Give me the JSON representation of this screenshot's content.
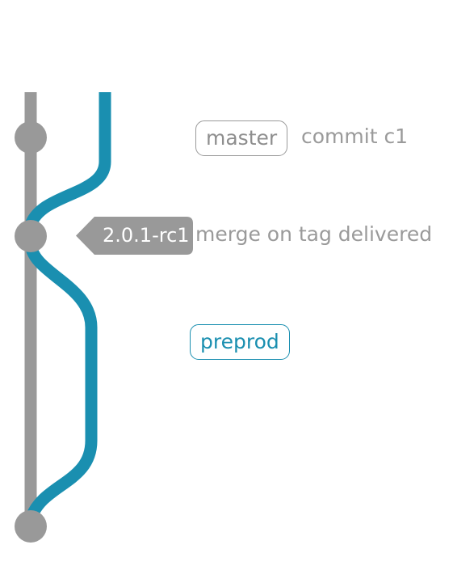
{
  "colors": {
    "master": "#999999",
    "preprod": "#1a8fb0",
    "tag": "#999999"
  },
  "branches": {
    "master": {
      "label": "master"
    },
    "preprod": {
      "label": "preprod"
    }
  },
  "commits": [
    {
      "id": "c1",
      "message": "commit c1"
    },
    {
      "id": "merge",
      "message": "merge on tag delivered",
      "tag": "2.0.1-rc1"
    },
    {
      "id": "merge-back",
      "message": ""
    }
  ],
  "tag": {
    "label": "2.0.1-rc1",
    "icon": "tag-icon"
  }
}
